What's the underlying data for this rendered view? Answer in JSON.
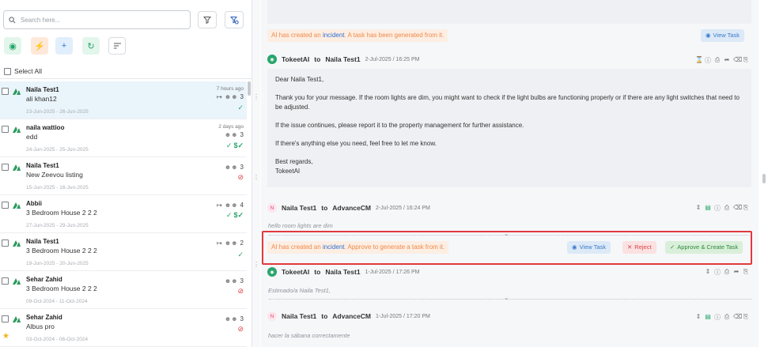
{
  "search": {
    "placeholder": "Search here..."
  },
  "toolbar": {
    "select_all_label": "Select All"
  },
  "conversations": [
    {
      "name": "Naila Test1",
      "subtitle": "ali khan12",
      "dates": "23-Jun-2025 - 26-Jun-2025",
      "time": "7 hours ago",
      "guests": "3",
      "active": true
    },
    {
      "name": "naila wattioo",
      "subtitle": "edd",
      "dates": "24-Jun-2025 - 25-Jun-2025",
      "time": "2 days ago",
      "guests": "3",
      "active": false
    },
    {
      "name": "Naila Test1",
      "subtitle": "New Zeevou listing",
      "dates": "15-Jun-2025 - 16-Jun-2025",
      "time": "",
      "guests": "3",
      "active": false
    },
    {
      "name": "Abbii",
      "subtitle": "3 Bedroom House 2 2 2",
      "dates": "27-Jun-2025 - 29-Jun-2025",
      "time": "",
      "guests": "4",
      "active": false
    },
    {
      "name": "Naila Test1",
      "subtitle": "3 Bedroom House 2 2 2",
      "dates": "19-Jun-2025 - 20-Jun-2025",
      "time": "",
      "guests": "2",
      "active": false
    },
    {
      "name": "Sehar Zahid",
      "subtitle": "3 Bedroom House 2 2 2",
      "dates": "09-Oct-2024 - 11-Oct-2024",
      "time": "",
      "guests": "3",
      "active": false
    },
    {
      "name": "Sehar Zahid",
      "subtitle": "Albus pro",
      "dates": "03-Oct-2024 - 06-Oct-2024",
      "time": "",
      "guests": "3",
      "active": false
    }
  ],
  "thread": {
    "notice1": {
      "prefix": "AI has created an ",
      "link": "incident",
      "suffix": ". A task has been generated from it."
    },
    "view_task_label": "View Task",
    "msg1": {
      "from": "TokeetAI",
      "to_word": "to",
      "to": "Naila Test1",
      "date": "2-Jul-2025 / 16:25 PM",
      "greeting": "Dear Naila Test1,",
      "p1": "Thank you for your message. If the room lights are dim, you might want to check if the light bulbs are functioning properly or if there are any light switches that need to be adjusted.",
      "p2": "If the issue continues, please report it to the property management for further assistance.",
      "p3": "If there's anything else you need, feel free to let me know.",
      "signoff": "Best regards,",
      "signature": "TokeetAI"
    },
    "msg2": {
      "avatar": "N",
      "from": "Naila Test1",
      "to_word": "to",
      "to": "AdvanceCM",
      "date": "2-Jul-2025 / 16:24 PM",
      "preview": "hello room lights are dim"
    },
    "notice2": {
      "prefix": "AI has created an ",
      "link": "incident",
      "suffix": ". Approve to generate a task from it."
    },
    "reject_label": "Reject",
    "approve_label": "Approve & Create Task",
    "msg3": {
      "from": "TokeetAI",
      "to_word": "to",
      "to": "Naila Test1",
      "date": "1-Jul-2025 / 17:26 PM",
      "preview": "Estimado/a Naila Test1,"
    },
    "msg4": {
      "avatar": "N",
      "from": "Naila Test1",
      "to_word": "to",
      "to": "AdvanceCM",
      "date": "1-Jul-2025 / 17:20 PM",
      "preview": "hacer la sábana correctamente"
    }
  },
  "colors": {
    "accent_green": "#28a56b",
    "notice_orange": "#ee8a4a",
    "link_blue": "#2d6fcf",
    "reject_red": "#d6454a",
    "highlight_red": "#e0393e"
  }
}
